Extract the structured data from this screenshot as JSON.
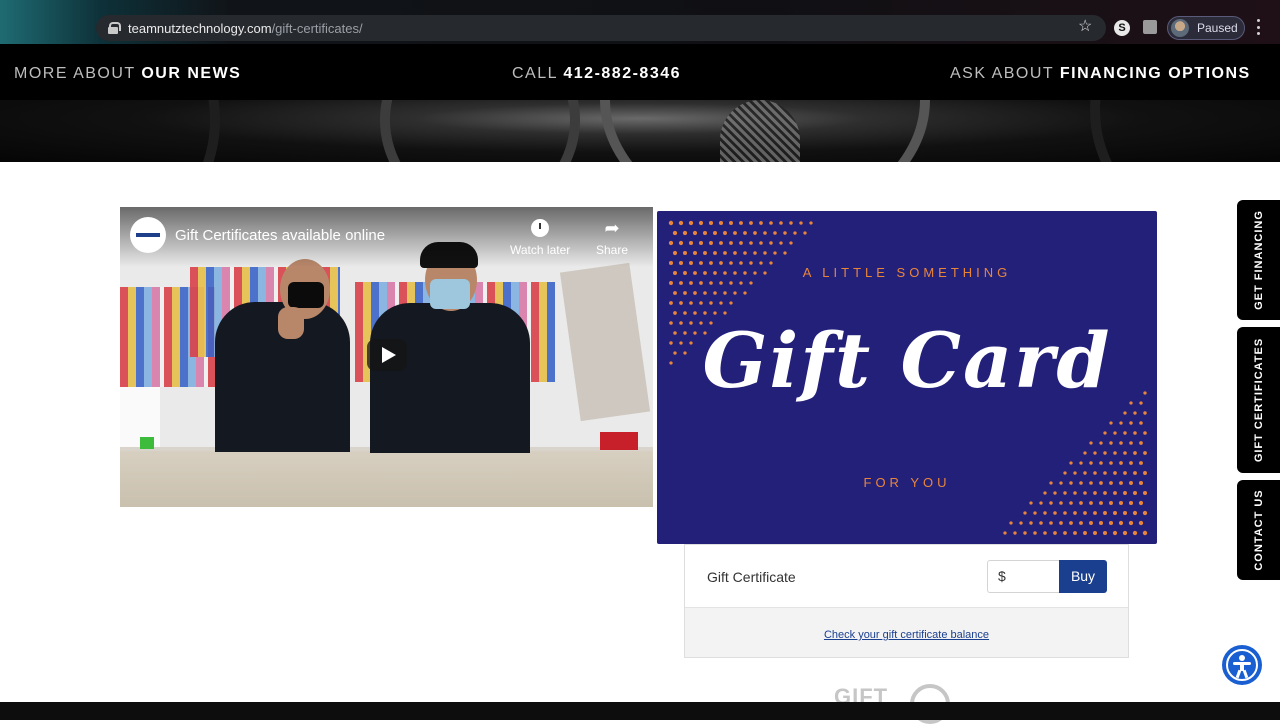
{
  "browser": {
    "url_host": "teamnutztechnology.com",
    "url_path": "/gift-certificates/",
    "extension_letter": "S",
    "profile_label": "Paused"
  },
  "topnav": {
    "news_prefix": "MORE ABOUT ",
    "news_strong": "OUR NEWS",
    "call_prefix": "CALL ",
    "call_number": "412-882-8346",
    "finance_prefix": "ASK ABOUT ",
    "finance_strong": "FINANCING OPTIONS"
  },
  "video": {
    "title": "Gift Certificates available online",
    "watch_later": "Watch later",
    "share": "Share"
  },
  "giftcard": {
    "tagline_top": "A LITTLE SOMETHING",
    "title": "Gift Card",
    "tagline_bottom": "FOR YOU",
    "dot_color": "#e9853a",
    "bg_color": "#23207a"
  },
  "purchase": {
    "label": "Gift Certificate",
    "currency_prefix": "$",
    "buy_label": "Buy",
    "balance_link": "Check your gift certificate balance"
  },
  "sidetabs": {
    "financing": "GET FINANCING",
    "certificates": "GIFT CERTIFICATES",
    "contact": "CONTACT US"
  },
  "footer_partial_logo": "GIFT"
}
